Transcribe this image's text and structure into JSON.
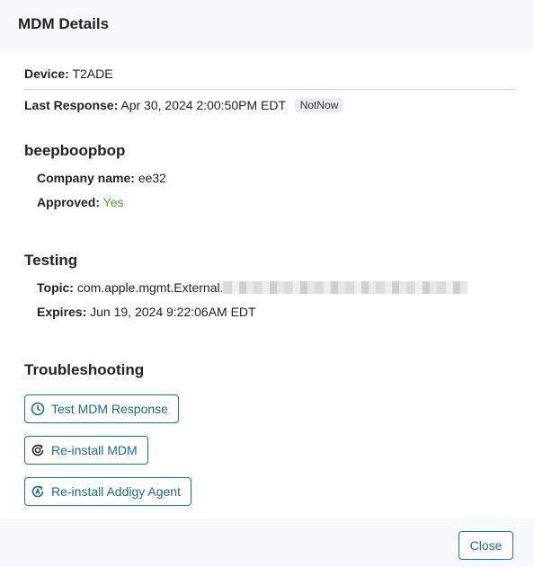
{
  "header": {
    "title": "MDM Details"
  },
  "device": {
    "label": "Device:",
    "value": "T2ADE"
  },
  "last_response": {
    "label": "Last Response:",
    "value": "Apr 30, 2024 2:00:50PM EDT",
    "badge": "NotNow"
  },
  "org": {
    "title": "beepboopbop",
    "company_label": "Company name:",
    "company_value": "ee32",
    "approved_label": "Approved:",
    "approved_value": "Yes"
  },
  "testing": {
    "title": "Testing",
    "topic_label": "Topic:",
    "topic_value": "com.apple.mgmt.External.",
    "expires_label": "Expires:",
    "expires_value": "Jun 19, 2024 9:22:06AM EDT"
  },
  "troubleshooting": {
    "title": "Troubleshooting",
    "buttons": [
      {
        "label": "Test MDM Response",
        "icon": "clock-icon"
      },
      {
        "label": "Re-install MDM",
        "icon": "reinstall-icon"
      },
      {
        "label": "Re-install Addigy Agent",
        "icon": "reinstall-agent-icon"
      }
    ]
  },
  "footer": {
    "close_label": "Close"
  },
  "colors": {
    "accent": "#1b7a8c",
    "approved": "#5aa02c",
    "header_bg": "#f7f8fa"
  }
}
